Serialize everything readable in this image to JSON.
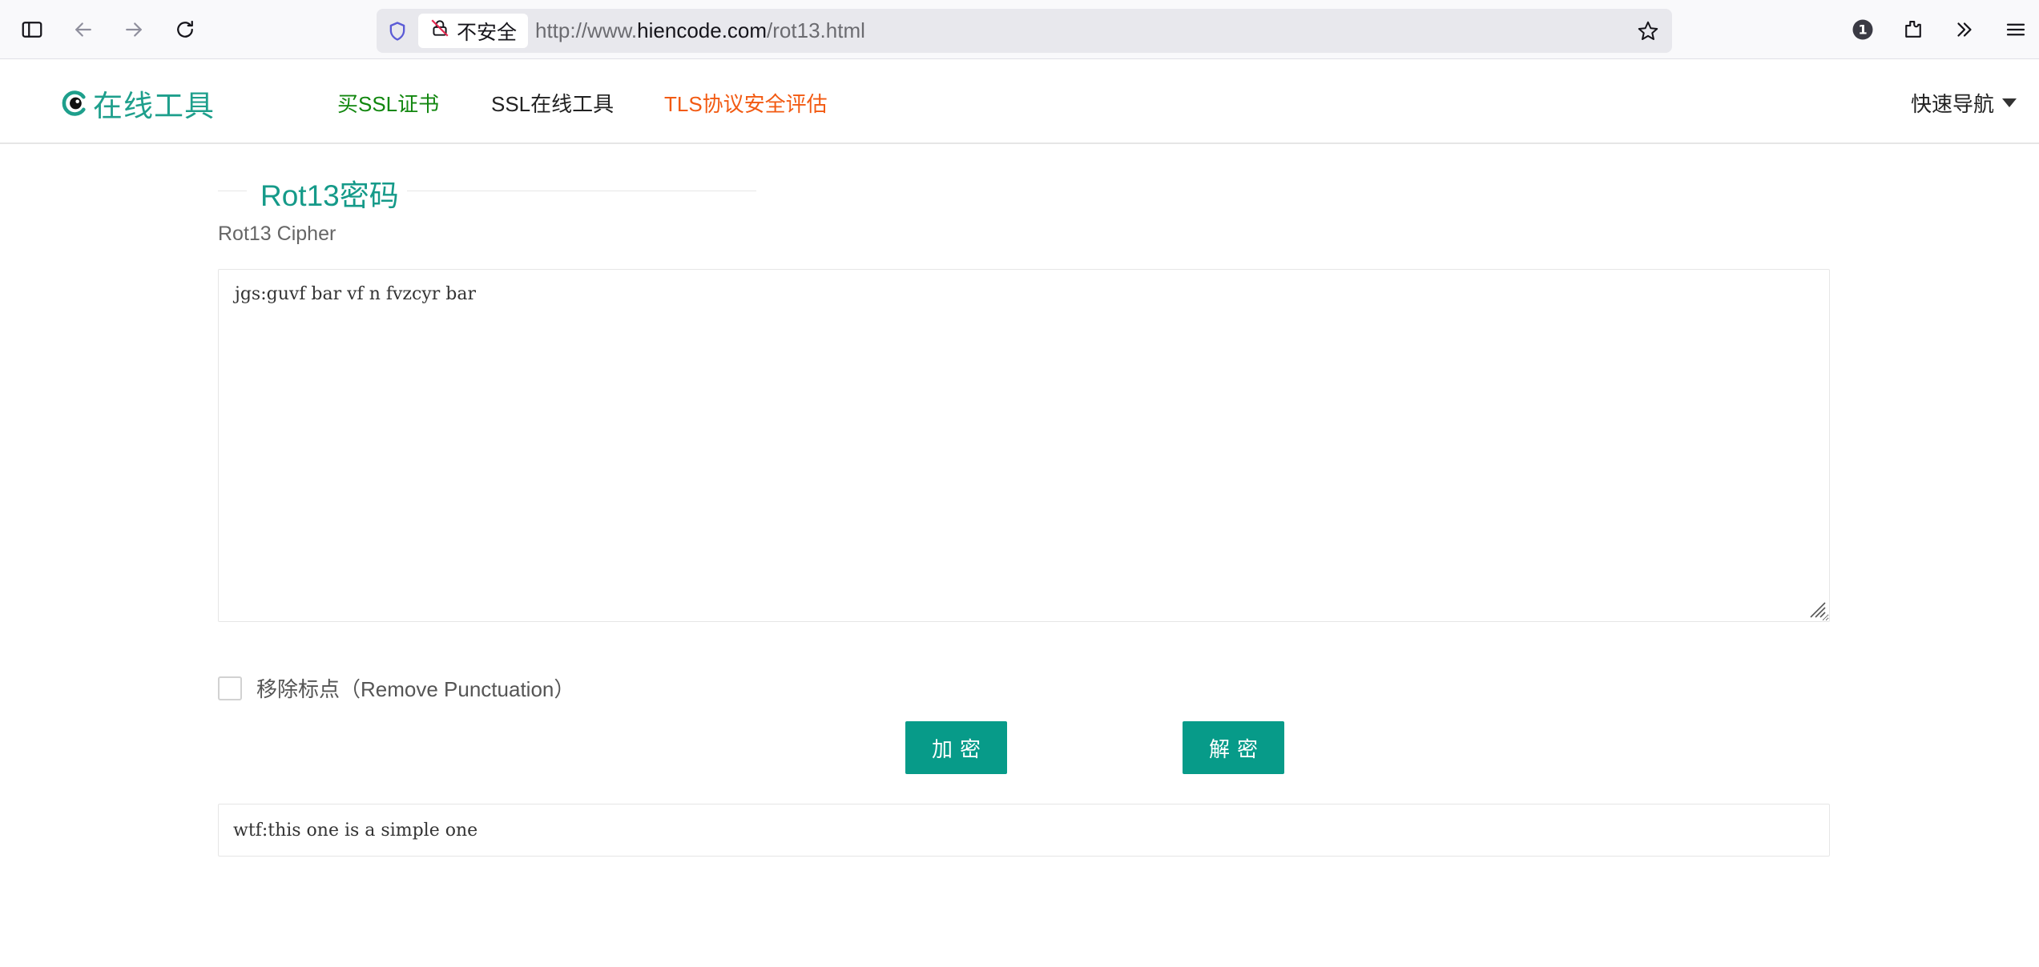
{
  "browser": {
    "security_label": "不安全",
    "url_prefix": "http://www.",
    "url_domain": "hiencode.com",
    "url_path": "/rot13.html",
    "extension_badge": "1",
    "icons": [
      "sidebar-icon",
      "back-icon",
      "forward-icon",
      "reload-icon",
      "shield-icon",
      "insecure-lock-icon",
      "bookmark-star-icon",
      "account-badge-icon",
      "extensions-icon",
      "overflow-icon",
      "menu-icon"
    ]
  },
  "header": {
    "logo_text": "在线工具",
    "nav": [
      {
        "label": "买SSL证书",
        "color": "#12870f"
      },
      {
        "label": "SSL在线工具",
        "color": "#222222"
      },
      {
        "label": "TLS协议安全评估",
        "color": "#f25a12"
      }
    ],
    "quick_nav_label": "快速导航"
  },
  "main": {
    "title": "Rot13密码",
    "subtitle": "Rot13 Cipher",
    "input_value": "jgs:guvf bar vf n fvzcyr bar",
    "checkbox_label": "移除标点（Remove Punctuation）",
    "checkbox_checked": false,
    "encrypt_label": "加密",
    "decrypt_label": "解密",
    "output_value": "wtf:this one is a simple one"
  },
  "colors": {
    "accent": "#079b89",
    "logo": "#1e9f8c",
    "title": "#159a89"
  }
}
